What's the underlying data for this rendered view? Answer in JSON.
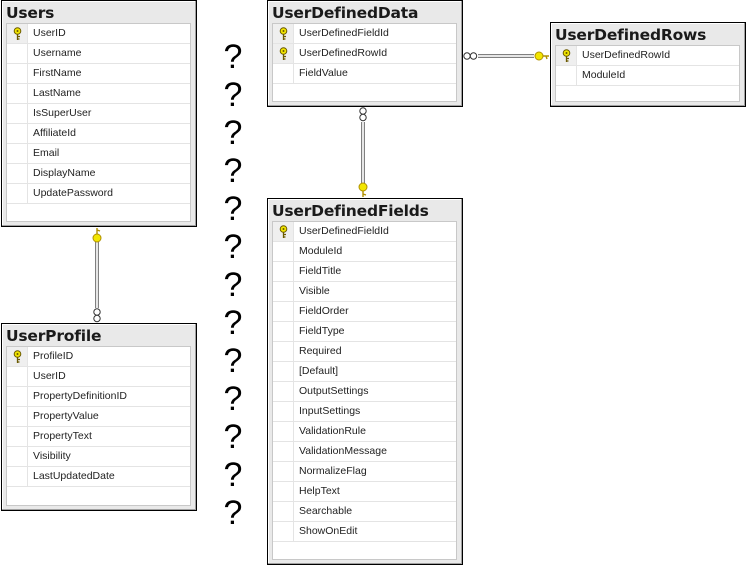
{
  "diagram": {
    "tables": {
      "users": {
        "title": "Users",
        "columns": [
          {
            "name": "UserID",
            "primary_key": true
          },
          {
            "name": "Username",
            "primary_key": false
          },
          {
            "name": "FirstName",
            "primary_key": false
          },
          {
            "name": "LastName",
            "primary_key": false
          },
          {
            "name": "IsSuperUser",
            "primary_key": false
          },
          {
            "name": "AffiliateId",
            "primary_key": false
          },
          {
            "name": "Email",
            "primary_key": false
          },
          {
            "name": "DisplayName",
            "primary_key": false
          },
          {
            "name": "UpdatePassword",
            "primary_key": false
          }
        ]
      },
      "user_profile": {
        "title": "UserProfile",
        "columns": [
          {
            "name": "ProfileID",
            "primary_key": true
          },
          {
            "name": "UserID",
            "primary_key": false
          },
          {
            "name": "PropertyDefinitionID",
            "primary_key": false
          },
          {
            "name": "PropertyValue",
            "primary_key": false
          },
          {
            "name": "PropertyText",
            "primary_key": false
          },
          {
            "name": "Visibility",
            "primary_key": false
          },
          {
            "name": "LastUpdatedDate",
            "primary_key": false
          }
        ]
      },
      "user_defined_data": {
        "title": "UserDefinedData",
        "columns": [
          {
            "name": "UserDefinedFieldId",
            "primary_key": true
          },
          {
            "name": "UserDefinedRowId",
            "primary_key": true
          },
          {
            "name": "FieldValue",
            "primary_key": false
          }
        ]
      },
      "user_defined_rows": {
        "title": "UserDefinedRows",
        "columns": [
          {
            "name": "UserDefinedRowId",
            "primary_key": true
          },
          {
            "name": "ModuleId",
            "primary_key": false
          }
        ]
      },
      "user_defined_fields": {
        "title": "UserDefinedFields",
        "columns": [
          {
            "name": "UserDefinedFieldId",
            "primary_key": true
          },
          {
            "name": "ModuleId",
            "primary_key": false
          },
          {
            "name": "FieldTitle",
            "primary_key": false
          },
          {
            "name": "Visible",
            "primary_key": false
          },
          {
            "name": "FieldOrder",
            "primary_key": false
          },
          {
            "name": "FieldType",
            "primary_key": false
          },
          {
            "name": "Required",
            "primary_key": false
          },
          {
            "name": "[Default]",
            "primary_key": false
          },
          {
            "name": "OutputSettings",
            "primary_key": false
          },
          {
            "name": "InputSettings",
            "primary_key": false
          },
          {
            "name": "ValidationRule",
            "primary_key": false
          },
          {
            "name": "ValidationMessage",
            "primary_key": false
          },
          {
            "name": "NormalizeFlag",
            "primary_key": false
          },
          {
            "name": "HelpText",
            "primary_key": false
          },
          {
            "name": "Searchable",
            "primary_key": false
          },
          {
            "name": "ShowOnEdit",
            "primary_key": false
          }
        ]
      }
    },
    "relationships": [
      {
        "from": "Users",
        "to": "UserProfile",
        "one_end": "Users",
        "many_end": "UserProfile"
      },
      {
        "from": "UserDefinedRows",
        "to": "UserDefinedData",
        "one_end": "UserDefinedRows",
        "many_end": "UserDefinedData"
      },
      {
        "from": "UserDefinedFields",
        "to": "UserDefinedData",
        "one_end": "UserDefinedFields",
        "many_end": "UserDefinedData"
      }
    ],
    "gap_marker": {
      "symbol": "?",
      "count": 13
    },
    "colors": {
      "key": "#f2e600",
      "title_bar": "#e9e9e9",
      "border": "#000000"
    }
  }
}
